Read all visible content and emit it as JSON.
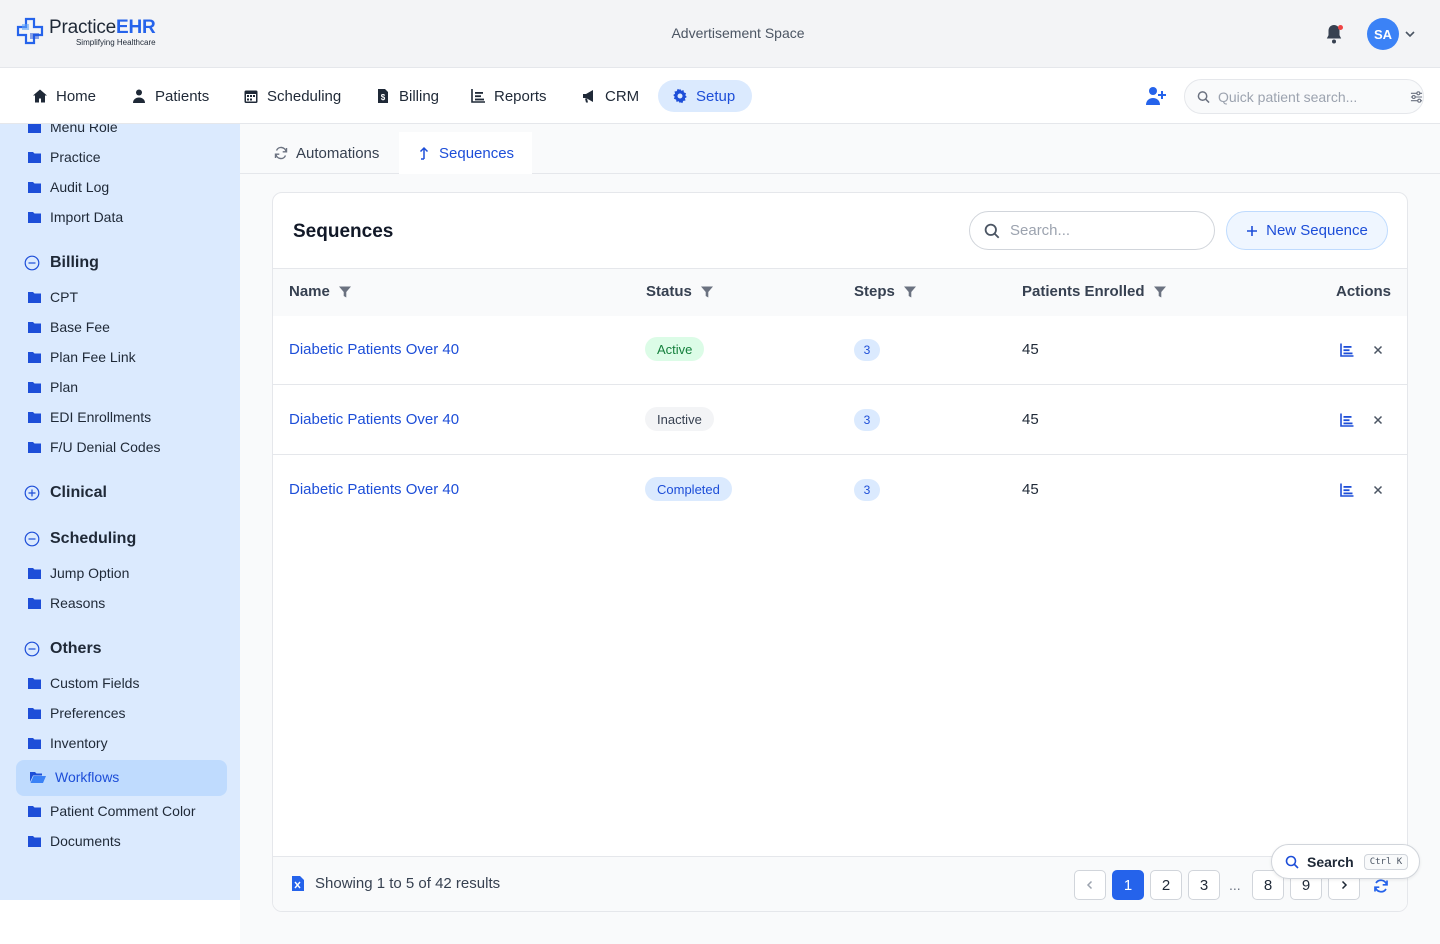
{
  "header": {
    "brand_name_a": "Practice",
    "brand_name_b": "EHR",
    "brand_tagline": "Simplifying Healthcare",
    "ad_text": "Advertisement Space",
    "avatar_initials": "SA",
    "notification_dot_color": "#ef4444"
  },
  "nav": {
    "items": [
      {
        "label": "Home",
        "icon": "home-icon"
      },
      {
        "label": "Patients",
        "icon": "user-icon"
      },
      {
        "label": "Scheduling",
        "icon": "calendar-icon"
      },
      {
        "label": "Billing",
        "icon": "file-invoice-icon"
      },
      {
        "label": "Reports",
        "icon": "bar-chart-icon"
      },
      {
        "label": "CRM",
        "icon": "megaphone-icon"
      },
      {
        "label": "Setup",
        "icon": "gear-icon",
        "active": true
      }
    ],
    "quick_search_placeholder": "Quick patient search..."
  },
  "sidebar": {
    "top_items": [
      "Menu Role",
      "Practice",
      "Audit Log",
      "Import Data"
    ],
    "billing": {
      "title": "Billing",
      "items": [
        "CPT",
        "Base Fee",
        "Plan Fee Link",
        "Plan",
        "EDI Enrollments",
        "F/U Denial Codes"
      ]
    },
    "clinical": {
      "title": "Clinical"
    },
    "scheduling": {
      "title": "Scheduling",
      "items": [
        "Jump Option",
        "Reasons"
      ]
    },
    "others": {
      "title": "Others",
      "items": [
        "Custom Fields",
        "Preferences",
        "Inventory",
        "Workflows",
        "Patient Comment Color",
        "Documents"
      ],
      "active": "Workflows"
    }
  },
  "tabs": [
    {
      "label": "Automations",
      "active": false
    },
    {
      "label": "Sequences",
      "active": true
    }
  ],
  "card": {
    "title": "Sequences",
    "search_placeholder": "Search...",
    "new_button_label": "New Sequence",
    "columns": [
      "Name",
      "Status",
      "Steps",
      "Patients Enrolled",
      "Actions"
    ],
    "rows": [
      {
        "name": "Diabetic Patients Over 40",
        "status": "Active",
        "steps": "3",
        "enrolled": "45"
      },
      {
        "name": "Diabetic Patients Over 40",
        "status": "Inactive",
        "steps": "3",
        "enrolled": "45"
      },
      {
        "name": "Diabetic Patients Over 40",
        "status": "Completed",
        "steps": "3",
        "enrolled": "45"
      }
    ],
    "footer_info": "Showing 1 to 5 of 42 results",
    "pagination": {
      "pages": [
        "1",
        "2",
        "3",
        "...",
        "8",
        "9"
      ],
      "current": "1"
    }
  },
  "floating_search": {
    "label": "Search",
    "shortcut": "Ctrl K"
  },
  "colors": {
    "accent": "#2563eb",
    "sidebar_bg": "#dbeafe",
    "active_status": "#15803d",
    "completed_status": "#1d4ed8"
  }
}
